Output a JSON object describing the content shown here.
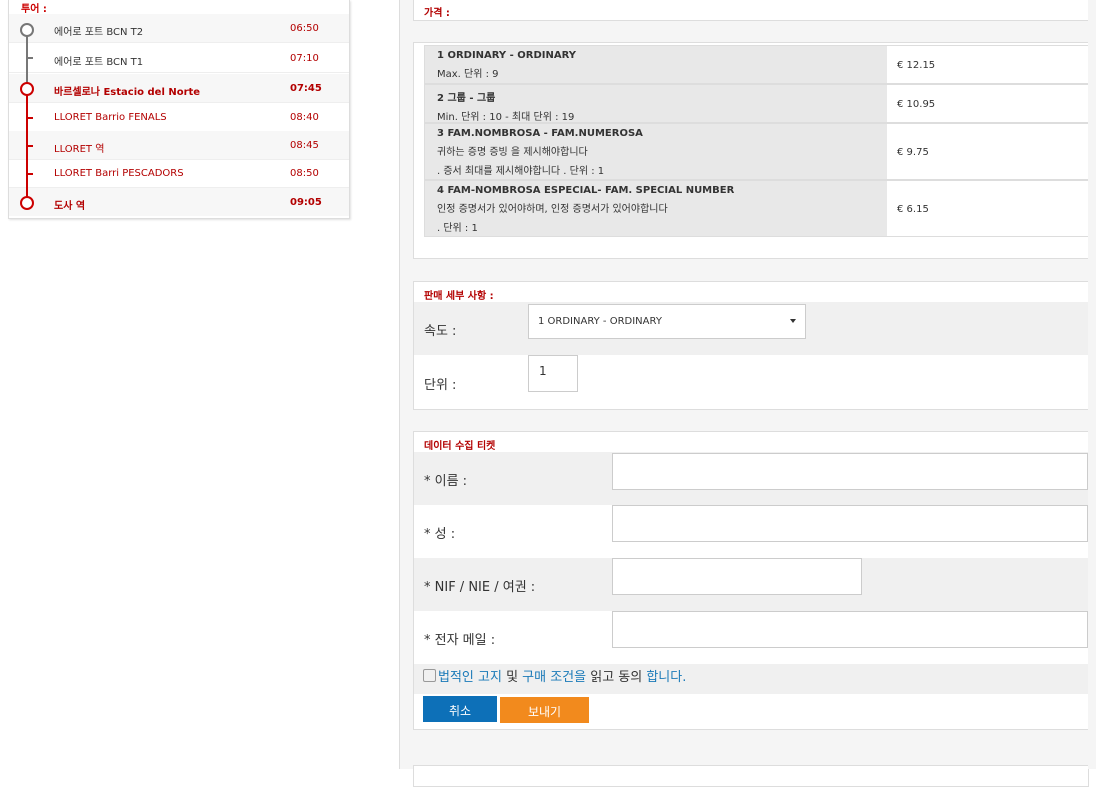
{
  "route": {
    "header": "투어 :",
    "stops": [
      {
        "name": "에어로 포트 BCN T2",
        "time": "06:50",
        "style": "gray"
      },
      {
        "name": "에어로 포트 BCN T1",
        "time": "07:10",
        "style": "gray"
      },
      {
        "name": "바르셀로나 Estacio del Norte",
        "time": "07:45",
        "style": "red-bold"
      },
      {
        "name": "LLORET Barrio FENALS",
        "time": "08:40",
        "style": "red"
      },
      {
        "name": "LLORET 역",
        "time": "08:45",
        "style": "red"
      },
      {
        "name": "LLORET Barri PESCADORS",
        "time": "08:50",
        "style": "red"
      },
      {
        "name": "도사 역",
        "time": "09:05",
        "style": "red-bold"
      }
    ]
  },
  "price_box": {
    "title": "가격 :",
    "rows": [
      {
        "title": "1 ORDINARY - ORDINARY",
        "lines": [
          "Max. 단위 : 9"
        ],
        "price": "€ 12.15"
      },
      {
        "title": "2 그룹 - 그룹",
        "lines": [
          "Min. 단위 : 10 - 최대 단위 : 19"
        ],
        "price": "€ 10.95"
      },
      {
        "title": "3 FAM.NOMBROSA - FAM.NUMEROSA",
        "lines": [
          "귀하는 증명 증빙 을 제시해야합니다",
          ". 증서 최대를 제시해야합니다 . 단위 : 1"
        ],
        "price": "€ 9.75"
      },
      {
        "title": "4 FAM-NOMBROSA ESPECIAL- FAM. SPECIAL NUMBER",
        "lines": [
          "인정 증명서가 있어야하며, 인정 증명서가 있어야합니다",
          ". 단위 : 1"
        ],
        "price": "€ 6.15"
      }
    ]
  },
  "sale_box": {
    "title": "판매 세부 사항 :",
    "rate_label": "속도 :",
    "rate_value": "1 ORDINARY - ORDINARY",
    "units_label": "단위 :",
    "units_value": "1"
  },
  "data_box": {
    "title": "데이터 수집 티켓",
    "name_label": "* 이름 :",
    "surname_label": "* 성 :",
    "doc_label": "* NIF / NIE / 여권 :",
    "email_label": "* 전자 메일 :",
    "terms": {
      "legal_link": "법적인 고지",
      "and": " 및 ",
      "conditions_link": "구매 조건을",
      "read": " 읽고 동의",
      "agree_link": " 합니다."
    },
    "cancel_label": "취소",
    "send_label": "보내기"
  },
  "colors": {
    "accent_red": "#b30000",
    "blue": "#0d70b8",
    "orange": "#f28a1d",
    "link": "#1a7ab8"
  }
}
